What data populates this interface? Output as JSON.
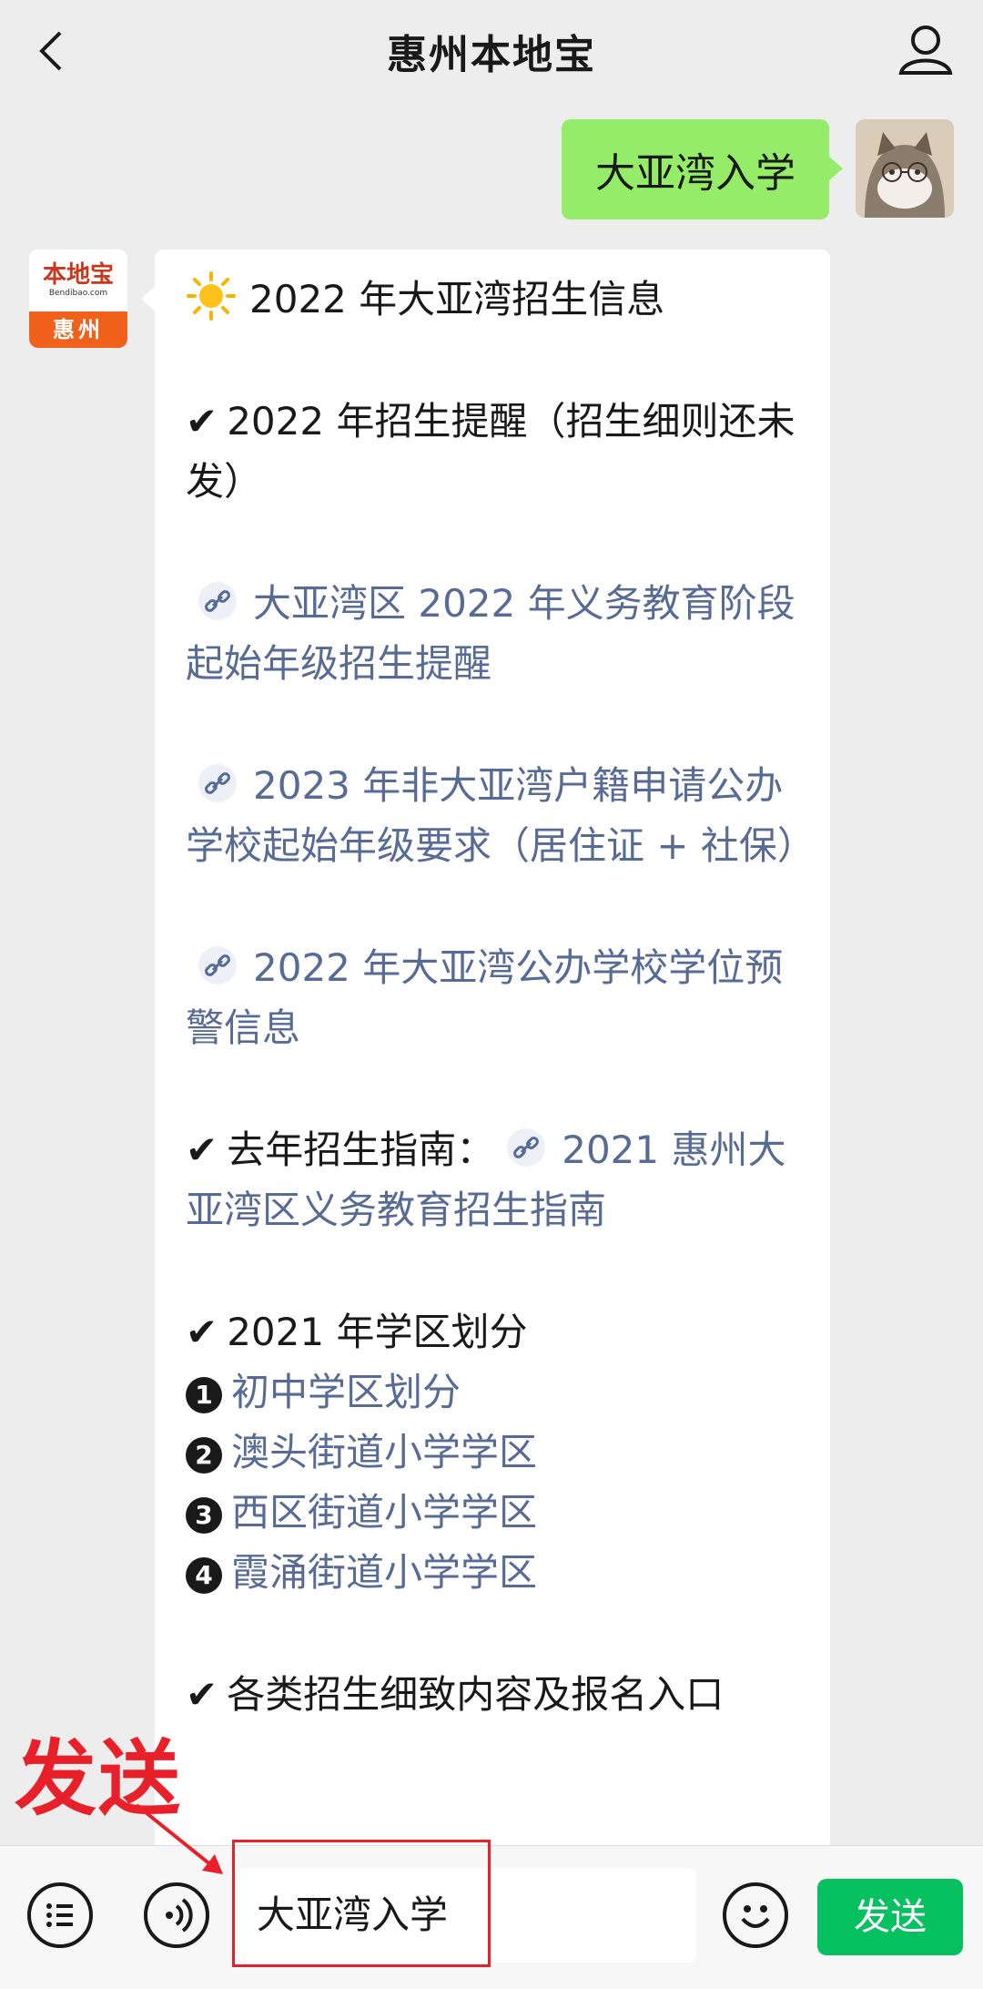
{
  "header": {
    "title": "惠州本地宝"
  },
  "chat": {
    "user_message": "大亚湾入学",
    "bot_avatar": {
      "brand": "本地宝",
      "url": "Bendibao.com",
      "city": "惠州"
    },
    "bot_message": {
      "title": "2022 年大亚湾招生信息",
      "section1_heading": "2022 年招生提醒（招生细则还未发）",
      "link1": "大亚湾区 2022 年义务教育阶段起始年级招生提醒",
      "link2": "2023 年非大亚湾户籍申请公办学校起始年级要求（居住证 + 社保）",
      "link3": "2022 年大亚湾公办学校学位预警信息",
      "section2_prefix": "去年招生指南：",
      "link4": "2021 惠州大亚湾区义务教育招生指南",
      "section3_heading": "2021 年学区划分",
      "district_items": [
        "初中学区划分",
        "澳头街道小学学区",
        "西区街道小学学区",
        "霞涌街道小学学区"
      ],
      "district_numbers": [
        "1",
        "2",
        "3",
        "4"
      ],
      "section4_heading": "各类招生细致内容及报名入口"
    }
  },
  "input": {
    "value": "大亚湾入学"
  },
  "send_button": {
    "label": "发送"
  },
  "annotation": {
    "label": "发送",
    "color": "#e8202a"
  },
  "colors": {
    "my_bubble": "#95ec69",
    "send_button": "#07c160",
    "link": "#576b95"
  }
}
